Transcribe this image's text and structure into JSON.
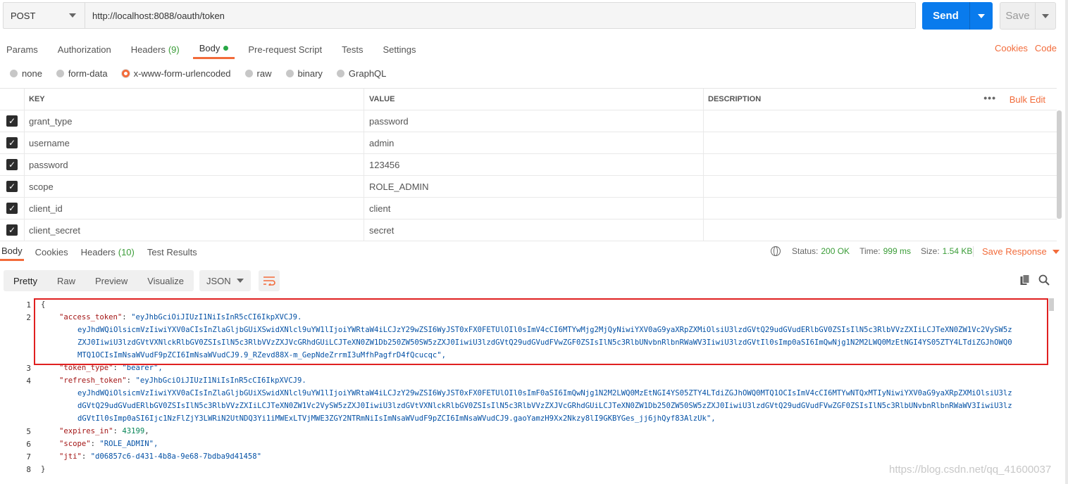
{
  "request": {
    "method": "POST",
    "url": "http://localhost:8088/oauth/token",
    "send_label": "Send",
    "save_label": "Save"
  },
  "request_tabs": [
    {
      "label": "Params"
    },
    {
      "label": "Authorization"
    },
    {
      "label": "Headers",
      "count": "(9)"
    },
    {
      "label": "Body"
    },
    {
      "label": "Pre-request Script"
    },
    {
      "label": "Tests"
    },
    {
      "label": "Settings"
    }
  ],
  "right_links": {
    "cookies": "Cookies",
    "code": "Code"
  },
  "body_modes": [
    "none",
    "form-data",
    "x-www-form-urlencoded",
    "raw",
    "binary",
    "GraphQL"
  ],
  "table": {
    "headers": {
      "key": "KEY",
      "value": "VALUE",
      "description": "DESCRIPTION",
      "bulk_edit": "Bulk Edit",
      "more": "•••"
    },
    "rows": [
      {
        "key": "grant_type",
        "value": "password"
      },
      {
        "key": "username",
        "value": "admin"
      },
      {
        "key": "password",
        "value": "123456"
      },
      {
        "key": "scope",
        "value": "ROLE_ADMIN"
      },
      {
        "key": "client_id",
        "value": "client"
      },
      {
        "key": "client_secret",
        "value": "secret"
      }
    ]
  },
  "response_tabs": [
    {
      "label": "Body"
    },
    {
      "label": "Cookies"
    },
    {
      "label": "Headers",
      "count": "(10)"
    },
    {
      "label": "Test Results"
    }
  ],
  "status": {
    "status_label": "Status:",
    "status_value": "200 OK",
    "time_label": "Time:",
    "time_value": "999 ms",
    "size_label": "Size:",
    "size_value": "1.54 KB",
    "save_response": "Save Response"
  },
  "view_modes": [
    "Pretty",
    "Raw",
    "Preview",
    "Visualize"
  ],
  "format": "JSON",
  "code_lines": {
    "l1": "{",
    "l2_key": "\"access_token\"",
    "l2_val": "\"eyJhbGciOiJIUzI1NiIsInR5cCI6IkpXVCJ9.",
    "l2_c1": "eyJhdWQiOlsicmVzIiwiYXV0aCIsInZlaGljbGUiXSwidXNlcl9uYW1lIjoiYWRtaW4iLCJzY29wZSI6WyJST0xFX0FETUlOIl0sImV4cCI6MTYwMjg2MjQyNiwiYXV0aG9yaXRpZXMiOlsiU3lzdGVtQ29udGVudERlbGV0ZSIsIlN5c3RlbVVzZXIiLCJTeXN0ZW1Vc2VySW5z",
    "l2_c2": "ZXJ0IiwiU3lzdGVtVXNlckRlbGV0ZSIsIlN5c3RlbVVzZXJVcGRhdGUiLCJTeXN0ZW1Db250ZW50SW5zZXJ0IiwiU3lzdGVtQ29udGVudFVwZGF0ZSIsIlN5c3RlbUNvbnRlbnRWaWV3IiwiU3lzdGVtIl0sImp0aSI6ImQwNjg1N2M2LWQ0MzEtNGI4YS05ZTY4LTdiZGJhOWQ0",
    "l2_c3": "MTQ1OCIsImNsaWVudF9pZCI6ImNsaWVudCJ9.9_RZevd88X-m_GepNdeZrrmI3uMfhPagfrD4fQcucqc\",",
    "l3_key": "\"token_type\"",
    "l3_val": "\"bearer\",",
    "l4_key": "\"refresh_token\"",
    "l4_val": "\"eyJhbGciOiJIUzI1NiIsInR5cCI6IkpXVCJ9.",
    "l4_c1": "eyJhdWQiOlsicmVzIiwiYXV0aCIsInZlaGljbGUiXSwidXNlcl9uYW1lIjoiYWRtaW4iLCJzY29wZSI6WyJST0xFX0FETUlOIl0sImF0aSI6ImQwNjg1N2M2LWQ0MzEtNGI4YS05ZTY4LTdiZGJhOWQ0MTQ1OCIsImV4cCI6MTYwNTQxMTIyNiwiYXV0aG9yaXRpZXMiOlsiU3lz",
    "l4_c2": "dGVtQ29udGVudERlbGV0ZSIsIlN5c3RlbVVzZXIiLCJTeXN0ZW1Vc2VySW5zZXJ0IiwiU3lzdGVtVXNlckRlbGV0ZSIsIlN5c3RlbVVzZXJVcGRhdGUiLCJTeXN0ZW1Db250ZW50SW5zZXJ0IiwiU3lzdGVtQ29udGVudFVwZGF0ZSIsIlN5c3RlbUNvbnRlbnRWaWV3IiwiU3lz",
    "l4_c3": "dGVtIl0sImp0aSI6Ijc1NzFlZjY3LWRiN2UtNDQ3Yi1iMWExLTVjMWE3ZGY2NTRmNiIsImNsaWVudF9pZCI6ImNsaWVudCJ9.gaoYamzH9Xx2Nkzy8lI9GKBYGes_jj6jhQyf83AlzUk\",",
    "l5_key": "\"expires_in\"",
    "l5_val": "43199",
    "l6_key": "\"scope\"",
    "l6_val": "\"ROLE_ADMIN\",",
    "l7_key": "\"jti\"",
    "l7_val": "\"d06857c6-d431-4b8a-9e68-7bdba9d41458\"",
    "l8": "}"
  },
  "line_numbers": [
    "1",
    "2",
    "3",
    "4",
    "5",
    "6",
    "7",
    "8"
  ],
  "watermark": "https://blog.csdn.net/qq_41600037",
  "colors": {
    "send": "#097bed",
    "accent": "#f26b3a",
    "success": "#3a9c37",
    "highlight": "#e02020"
  }
}
